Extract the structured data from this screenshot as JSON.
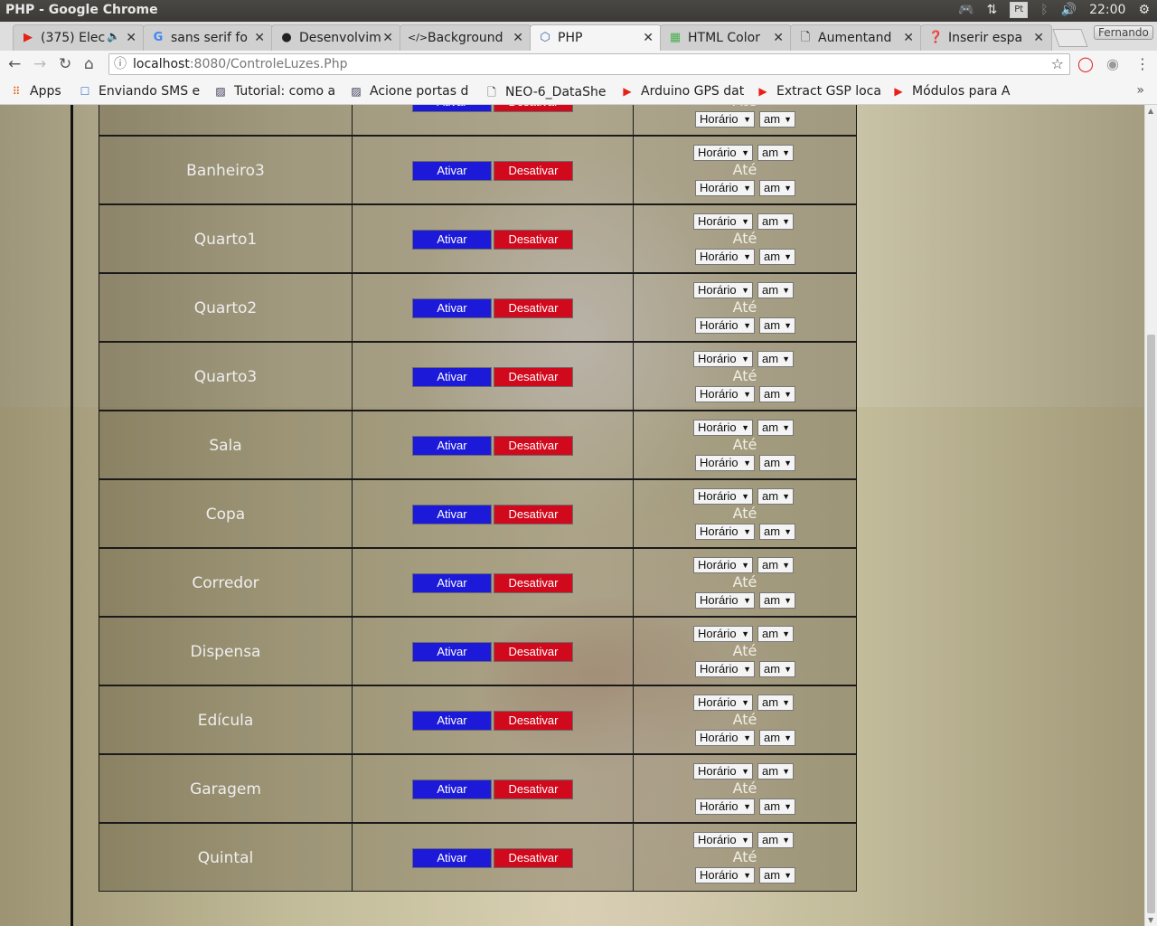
{
  "os": {
    "window_title": "PHP - Google Chrome",
    "keyboard_layout": "Pt",
    "clock": "22:00"
  },
  "tabs": [
    {
      "label": "(375) Elec",
      "icon": "youtube-icon",
      "color": "#e62117"
    },
    {
      "label": "sans serif fo",
      "icon": "google-icon",
      "color": "#4285f4"
    },
    {
      "label": "Desenvolvim",
      "icon": "github-icon",
      "color": "#222222"
    },
    {
      "label": "Background",
      "icon": "code-icon",
      "color": "#222222"
    },
    {
      "label": "PHP",
      "icon": "php-icon",
      "color": "#3b5fa7",
      "active": true
    },
    {
      "label": "HTML Color",
      "icon": "html-color-icon",
      "color": "#4caf50"
    },
    {
      "label": "Aumentand",
      "icon": "page-icon",
      "color": "#555555"
    },
    {
      "label": "Inserir espa",
      "icon": "help-icon",
      "color": "#d81b1b"
    }
  ],
  "profile_name": "Fernando",
  "address": {
    "host": "localhost",
    "rest": ":8080/ControleLuzes.Php"
  },
  "bookmarks": [
    {
      "label": "Apps",
      "icon": "apps-grid-icon"
    },
    {
      "label": "Enviando SMS e",
      "icon": "sms-icon"
    },
    {
      "label": "Tutorial: como a",
      "icon": "image-icon"
    },
    {
      "label": "Acione portas d",
      "icon": "image-icon"
    },
    {
      "label": "NEO-6_DataShe",
      "icon": "page-icon"
    },
    {
      "label": "Arduino GPS dat",
      "icon": "youtube-icon"
    },
    {
      "label": "Extract GSP loca",
      "icon": "youtube-icon"
    },
    {
      "label": "Módulos para A",
      "icon": "youtube-icon"
    }
  ],
  "controls": {
    "activate_label": "Ativar",
    "deactivate_label": "Desativar",
    "time_select": "Horário",
    "ampm_select": "am",
    "until_label": "Até"
  },
  "rooms": [
    "",
    "Banheiro3",
    "Quarto1",
    "Quarto2",
    "Quarto3",
    "Sala",
    "Copa",
    "Corredor",
    "Dispensa",
    "Edícula",
    "Garagem",
    "Quintal"
  ],
  "colors": {
    "activate": "#1c1ad8",
    "deactivate": "#d1091c"
  }
}
